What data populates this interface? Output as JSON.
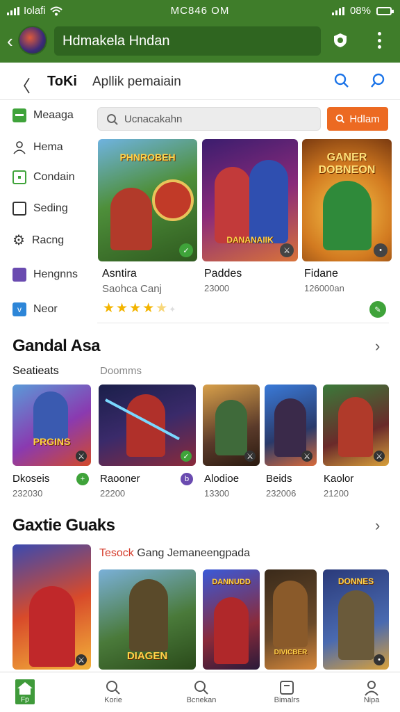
{
  "status_bar": {
    "left_text": "Iolaﬁ",
    "time": "MC846 OM",
    "battery": "08%"
  },
  "app_bar": {
    "title": "Hdmakela Hndan"
  },
  "toolbar": {
    "brand": "ToKi",
    "subtitle": "Apllik pemaiain"
  },
  "sidebar": {
    "items": [
      {
        "label": "Meaaga",
        "icon": "green-square-icon"
      },
      {
        "label": "Hema",
        "icon": "person-icon"
      },
      {
        "label": "Condain",
        "icon": "green-outline-square-icon"
      },
      {
        "label": "Seding",
        "icon": "screen-icon"
      },
      {
        "label": "Racng",
        "icon": "gear-icon"
      },
      {
        "label": "Hengnns",
        "icon": "purple-square-icon"
      },
      {
        "label": "Neor",
        "icon": "blue-square-icon"
      }
    ]
  },
  "search": {
    "placeholder": "Ucnacakahn",
    "button_label": "Hdlam"
  },
  "featured": {
    "cards": [
      {
        "name": "Asntira",
        "sub": "Saohca Canj",
        "art_title": "PHNROBEH"
      },
      {
        "name": "Paddes",
        "sub": "23000",
        "art_title": "DANANAIIK"
      },
      {
        "name": "Fidane",
        "sub": "126000an",
        "art_title": "GANER DOBNEON"
      }
    ],
    "rating": 4.5
  },
  "section1": {
    "title": "Gandal Asa",
    "tabs": [
      "Seatieats",
      "Doomms"
    ],
    "cards": [
      {
        "name": "Dkoseis",
        "sub": "232030",
        "art_title": "PRGINS"
      },
      {
        "name": "Raooner",
        "sub": "22200",
        "art_title": ""
      },
      {
        "name": "Alodioe",
        "sub": "13300",
        "art_title": ""
      },
      {
        "name": "Beids",
        "sub": "232006",
        "art_title": ""
      },
      {
        "name": "Kaolor",
        "sub": "21200",
        "art_title": ""
      }
    ]
  },
  "section2": {
    "title": "Gaxtie Guaks",
    "subtitle_red": "Tesock",
    "subtitle": "Gang Jemaneengpada",
    "cards": [
      {
        "art_title": ""
      },
      {
        "art_title": "DIAGEN"
      },
      {
        "art_title": "DANNUDD"
      },
      {
        "art_title": "DIVICBER"
      },
      {
        "art_title": "DONNES"
      }
    ]
  },
  "bottom_nav": {
    "items": [
      {
        "label": "Fp",
        "icon": "home-icon"
      },
      {
        "label": "Korie",
        "icon": "search-icon"
      },
      {
        "label": "Bcnekan",
        "icon": "search-icon"
      },
      {
        "label": "Bimalrs",
        "icon": "card-icon"
      },
      {
        "label": "Nipa",
        "icon": "profile-icon"
      }
    ]
  },
  "colors": {
    "brand_green": "#3f7d2a",
    "accent_orange": "#ec6a22",
    "link_blue": "#1a73e8"
  }
}
